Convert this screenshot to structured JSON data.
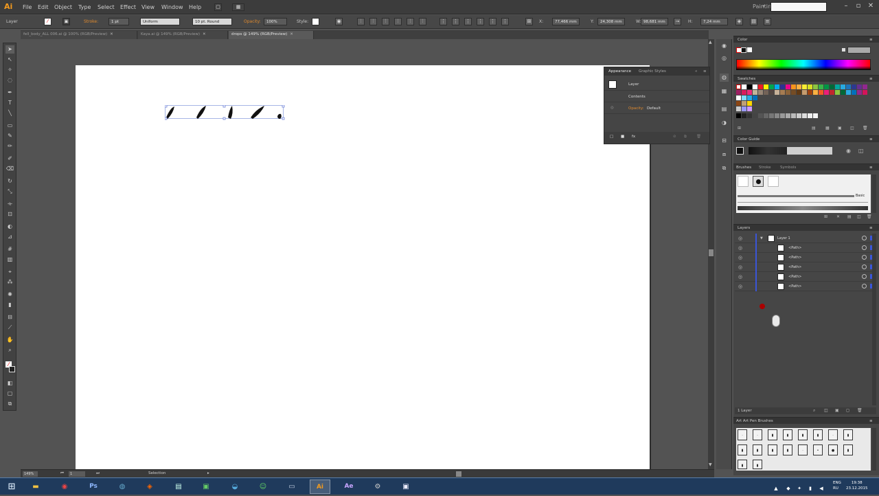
{
  "app": {
    "logo": "Ai",
    "workspace": "Painting",
    "search_value": ""
  },
  "menu": [
    "File",
    "Edit",
    "Object",
    "Type",
    "Select",
    "Effect",
    "View",
    "Window",
    "Help"
  ],
  "control_bar": {
    "selection_label": "Layer",
    "stroke_label": "Stroke:",
    "stroke_weight": "1 pt",
    "uniform": "Uniform",
    "brush": "10 pt. Round",
    "opacity_label": "Opacity:",
    "opacity_value": "100%",
    "style_label": "Style:",
    "x_value": "77,466 mm",
    "y_value": "24,308 mm",
    "w_value": "98,681 mm",
    "h_value": "7,24 mm"
  },
  "doc_tabs": [
    {
      "label": "fell_body_ALL 006.ai @ 100% (RGB/Preview)",
      "active": false
    },
    {
      "label": "Kaya.ai @ 149% (RGB/Preview)",
      "active": false
    },
    {
      "label": "drops @ 149% (RGB/Preview)",
      "active": true
    }
  ],
  "status_bar": {
    "zoom": "149%",
    "page": "1",
    "mode": "Selection"
  },
  "appearance_panel": {
    "tabs": [
      "Appearance",
      "Graphic Styles"
    ],
    "rows": {
      "layer": "Layer",
      "contents": "Contents",
      "opacity_label": "Opacity:",
      "opacity_value": "Default"
    }
  },
  "panels": {
    "color": "Color",
    "swatches": "Swatches",
    "color_guide": "Color Guide",
    "brushes_tabs": [
      "Brushes",
      "Stroke",
      "Symbols"
    ],
    "brush_basic": "Basic",
    "layers": "Layers",
    "layers_footer": "1 Layer",
    "art_brushes": "Art Art Pen Brushes"
  },
  "layers": {
    "top": {
      "name": "Layer 1"
    },
    "items": [
      "<Path>",
      "<Path>",
      "<Path>",
      "<Path>",
      "<Path>"
    ]
  },
  "taskbar": {
    "apps": [
      "Ps",
      "Ai",
      "Ae"
    ],
    "lang": "ENG",
    "lang2": "RU",
    "time": "19:38",
    "date": "23.12.2015"
  },
  "colors": {
    "accent": "#f39a1e",
    "selection": "#3a55d8"
  }
}
